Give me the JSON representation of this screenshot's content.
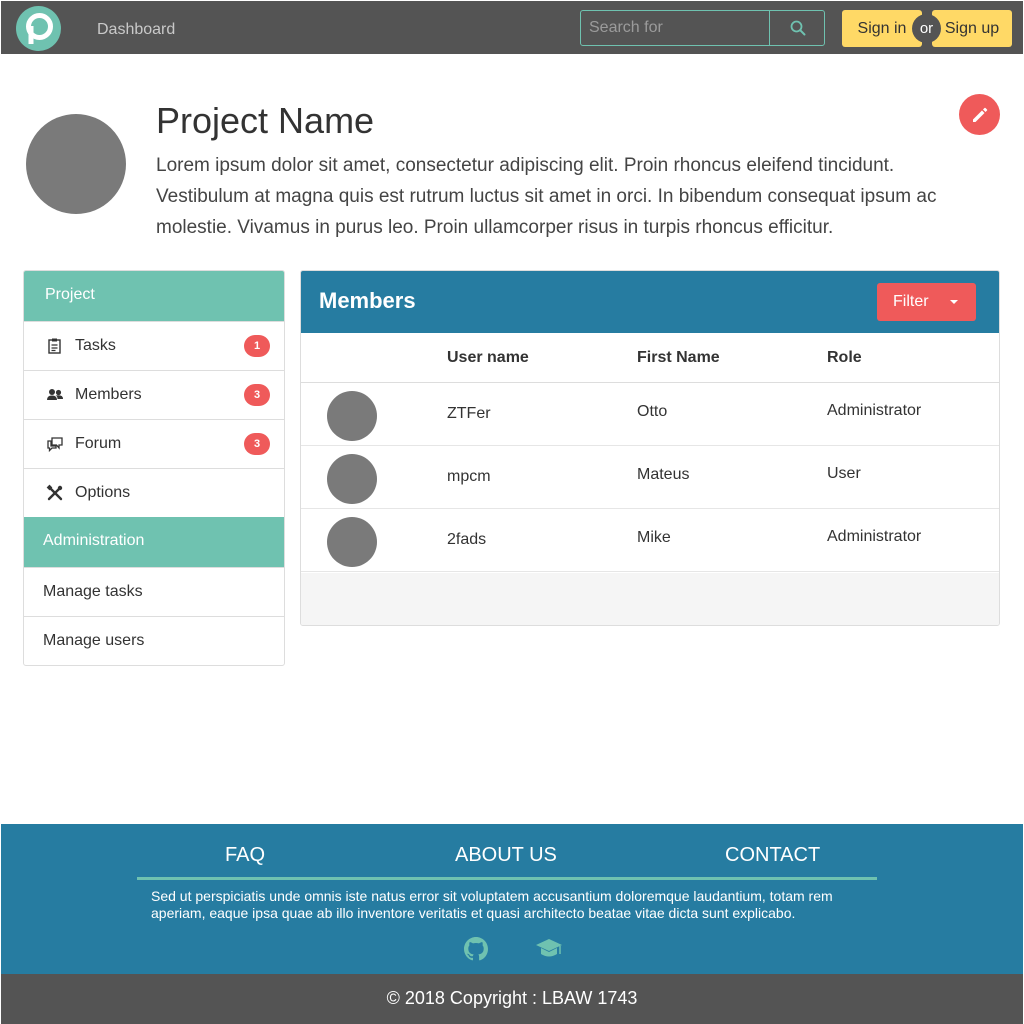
{
  "nav": {
    "link": "Dashboard",
    "search_placeholder": "Search for",
    "signin": "Sign in",
    "or": "or",
    "signup": "Sign up"
  },
  "project": {
    "title": "Project Name",
    "description": "Lorem ipsum dolor sit amet, consectetur adipiscing elit. Proin rhoncus eleifend tincidunt. Vestibulum at magna quis est rutrum luctus sit amet in orci. In bibendum consequat ipsum ac molestie. Vivamus in purus leo. Proin ullamcorper risus in turpis rhoncus efficitur."
  },
  "sidebar": {
    "project_heading": "Project",
    "items": [
      {
        "label": "Tasks",
        "badge": "1",
        "icon": "clipboard-icon"
      },
      {
        "label": "Members",
        "badge": "3",
        "icon": "users-icon"
      },
      {
        "label": "Forum",
        "badge": "3",
        "icon": "chat-icon"
      },
      {
        "label": "Options",
        "icon": "tools-icon"
      }
    ],
    "admin_heading": "Administration",
    "admin_items": [
      "Manage tasks",
      "Manage users"
    ]
  },
  "members": {
    "title": "Members",
    "filter": "Filter",
    "columns": [
      "User name",
      "First Name",
      "Role"
    ],
    "rows": [
      {
        "username": "ZTFer",
        "first_name": "Otto",
        "role": "Administrator"
      },
      {
        "username": "mpcm",
        "first_name": "Mateus",
        "role": "User"
      },
      {
        "username": "2fads",
        "first_name": "Mike",
        "role": "Administrator"
      }
    ]
  },
  "footer": {
    "links": [
      "FAQ",
      "ABOUT US",
      "CONTACT"
    ],
    "text": "Sed ut perspiciatis unde omnis iste natus error sit voluptatem accusantium doloremque laudantium, totam rem aperiam, eaque ipsa quae ab illo inventore veritatis et quasi architecto beatae vitae dicta sunt explicabo.",
    "icons": [
      "github-icon",
      "graduation-cap-icon"
    ],
    "copyright": "© 2018 Copyright : LBAW 1743"
  },
  "colors": {
    "navbar": "#545454",
    "accent_teal": "#6fc2b0",
    "primary_blue": "#267ca1",
    "danger_red": "#ef5a5a",
    "auth_yellow": "#ffd966"
  }
}
